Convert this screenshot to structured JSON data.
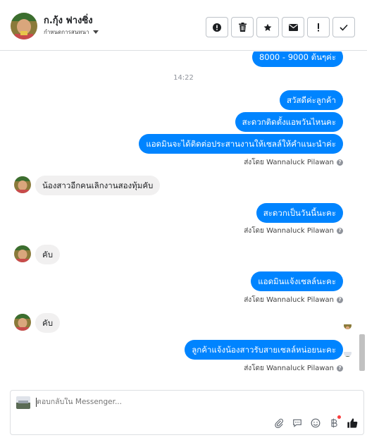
{
  "header": {
    "contact_name": "ก.กุ้ง ฟางซิ่ง",
    "subtitle": "กำหนดการสนทนา",
    "toolbar": [
      {
        "name": "report-spam",
        "icon": "alert-circle-icon"
      },
      {
        "name": "delete",
        "icon": "trash-icon"
      },
      {
        "name": "star",
        "icon": "star-icon"
      },
      {
        "name": "mark-unread",
        "icon": "envelope-icon"
      },
      {
        "name": "flag-important",
        "icon": "exclamation-icon"
      },
      {
        "name": "mark-done",
        "icon": "checkmark-icon"
      }
    ]
  },
  "thread": {
    "top_partial_message": "8000 - 9000 ต้นๆค่ะ",
    "timestamp": "14:22",
    "messages": [
      {
        "dir": "out",
        "text": "สวัสดีค่ะลูกค้า"
      },
      {
        "dir": "out",
        "text": "สะดวกติดตั้งแอพวันไหนคะ"
      },
      {
        "dir": "out",
        "text": "แอดมินจะได้ติดต่อประสานงานให้เซลล์ให้คำแนะนำค่ะ"
      },
      {
        "dir": "in",
        "text": "น้องสาวอีกคนเลิกงานสองทุ้มคับ"
      },
      {
        "dir": "out",
        "text": "สะดวกเป็นวันนี้นะคะ"
      },
      {
        "dir": "in",
        "text": "คับ"
      },
      {
        "dir": "out",
        "text": "แอดมินแจ้งเซลล์นะคะ"
      },
      {
        "dir": "in",
        "text": "คับ"
      },
      {
        "dir": "out",
        "text": "ลูกค้าแจ้งน้องสาวรับสายเซลล์หน่อยนะคะ"
      }
    ],
    "sent_by_label": "ส่งโดย Wannaluck Pilawan",
    "help_glyph": "?"
  },
  "composer": {
    "placeholder": "ตอบกลับใน Messenger...",
    "tools": [
      "paperclip-icon",
      "chat-bubble-icon",
      "emoji-icon",
      "baht-icon",
      "thumbs-up-icon"
    ]
  },
  "colors": {
    "outgoing_bubble": "#0084ff",
    "incoming_bubble": "#f1f0f0",
    "border": "#dddfe2"
  }
}
